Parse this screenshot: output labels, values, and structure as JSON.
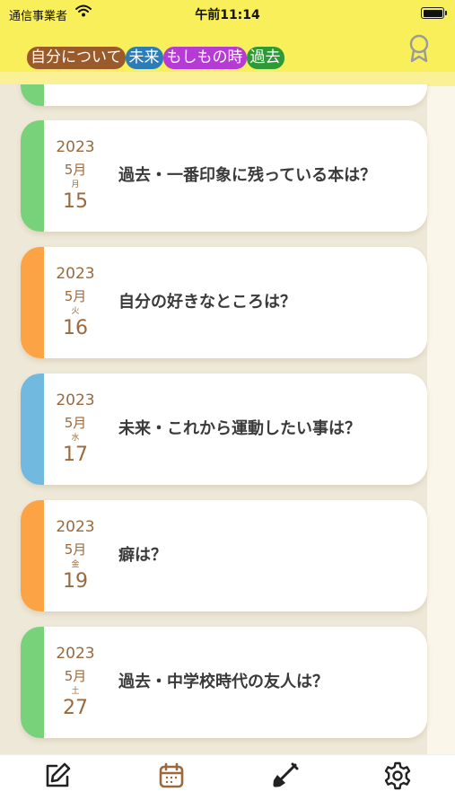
{
  "status_bar": {
    "carrier": "通信事業者",
    "time": "午前11:14"
  },
  "header": {
    "chips": [
      {
        "label": "自分について",
        "color": "#9a5a2a"
      },
      {
        "label": "未来",
        "color": "#2b7db8"
      },
      {
        "label": "もしもの時",
        "color": "#b63bd4"
      },
      {
        "label": "過去",
        "color": "#2e9a36"
      }
    ],
    "award_icon": "award-ribbon-icon"
  },
  "entries": [
    {
      "year": "2023",
      "month": "5月",
      "weekday": "月",
      "day": "15",
      "question": "過去・一番印象に残っている本は？",
      "color": "#77d27a"
    },
    {
      "year": "2023",
      "month": "5月",
      "weekday": "火",
      "day": "16",
      "question": "自分の好きなところは？",
      "color": "#fca346"
    },
    {
      "year": "2023",
      "month": "5月",
      "weekday": "水",
      "day": "17",
      "question": "未来・これから運動したい事は？",
      "color": "#72b9e0"
    },
    {
      "year": "2023",
      "month": "5月",
      "weekday": "金",
      "day": "19",
      "question": "癖は？",
      "color": "#fca346"
    },
    {
      "year": "2023",
      "month": "5月",
      "weekday": "土",
      "day": "27",
      "question": "過去・中学校時代の友人は？",
      "color": "#77d27a"
    }
  ],
  "partial_top_entry_color": "#77d27a",
  "tabbar": {
    "tabs": [
      {
        "icon": "edit-icon",
        "color": "#222222"
      },
      {
        "icon": "calendar-icon",
        "color": "#9a6a3e",
        "selected": true
      },
      {
        "icon": "shovel-icon",
        "color": "#222222"
      },
      {
        "icon": "gear-icon",
        "color": "#222222"
      }
    ]
  }
}
